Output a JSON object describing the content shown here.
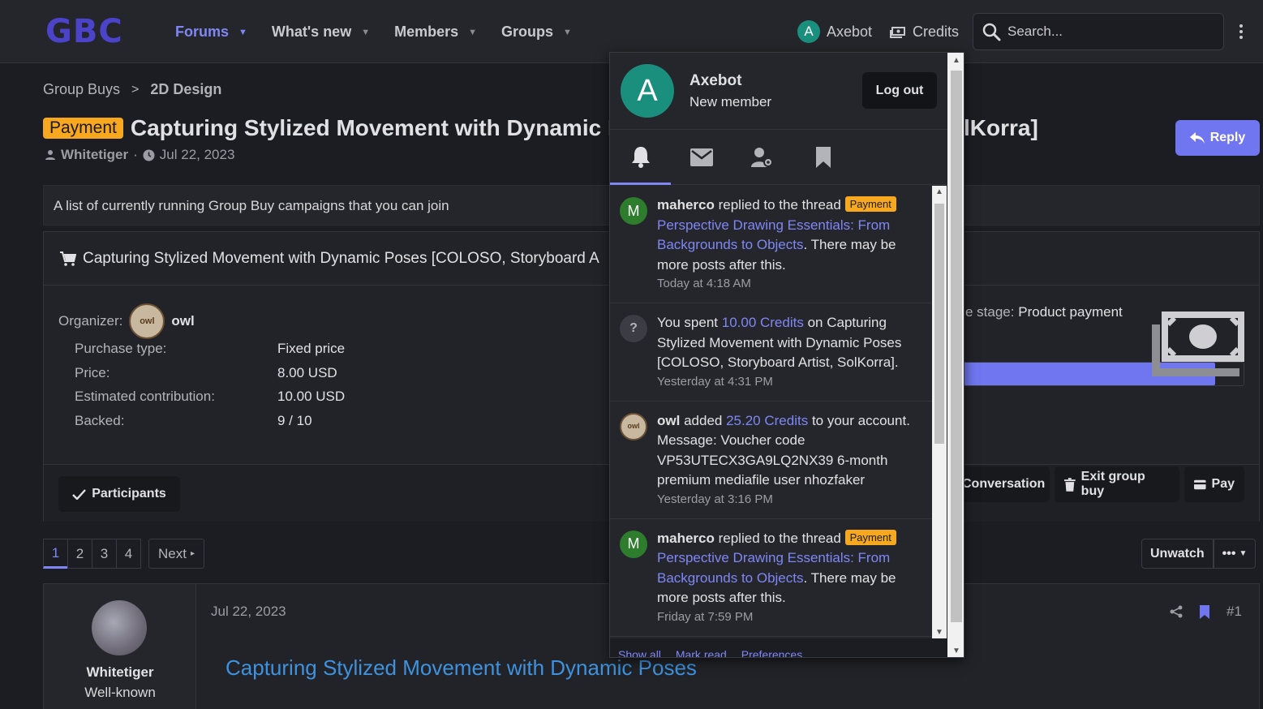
{
  "header": {
    "logo": "GBC",
    "nav": [
      {
        "label": "Forums",
        "active": true
      },
      {
        "label": "What's new",
        "active": false
      },
      {
        "label": "Members",
        "active": false
      },
      {
        "label": "Groups",
        "active": false
      }
    ],
    "user_initial": "A",
    "user_name": "Axebot",
    "credits_label": "Credits",
    "search_placeholder": "Search..."
  },
  "breadcrumb": [
    "Group Buys",
    "2D Design"
  ],
  "thread": {
    "prefix": "Payment",
    "title": "Capturing Stylized Movement with Dynamic Po",
    "title_tail": "lKorra]",
    "author": "Whitetiger",
    "date": "Jul 22, 2023",
    "reply_label": "Reply"
  },
  "description": "A list of currently running Group Buy campaigns that you can join",
  "groupbuy": {
    "heading": "Capturing Stylized Movement with Dynamic Poses [COLOSO, Storyboard A",
    "organizer_label": "Organizer:",
    "organizer_name": "owl",
    "owl_avatar_text": "owl",
    "details": [
      {
        "k": "Purchase type:",
        "v": "Fixed price"
      },
      {
        "k": "Price:",
        "v": "8.00 USD"
      },
      {
        "k": "Estimated contribution:",
        "v": "10.00 USD"
      },
      {
        "k": "Backed:",
        "v": "9 / 10"
      }
    ],
    "stage_label": "e stage:",
    "stage_value": "Product payment",
    "progress": 0.9,
    "participants_label": "Participants",
    "conversation_label": "Conversation",
    "exit_label": "Exit group buy",
    "pay_label": "Pay"
  },
  "pagination": {
    "pages": [
      "1",
      "2",
      "3",
      "4"
    ],
    "current": "1",
    "next_label": "Next",
    "unwatch_label": "Unwatch"
  },
  "post": {
    "author": "Whitetiger",
    "role": "Well-known",
    "date": "Jul 22, 2023",
    "title": "Capturing Stylized Movement with Dynamic Poses",
    "number": "#1"
  },
  "popup": {
    "initial": "A",
    "name": "Axebot",
    "role": "New member",
    "logout_label": "Log out",
    "notifications": [
      {
        "avatar": "M",
        "who": "maherco",
        "text1": "replied to the thread",
        "badge": "Payment",
        "link": "Perspective Drawing Essentials: From Backgrounds to Objects",
        "text2": ". There may be more posts after this.",
        "time": "Today at 4:18 AM"
      },
      {
        "avatar": "?",
        "pre": "You spent",
        "link": "10.00 Credits",
        "text2": "on Capturing Stylized Movement with Dynamic Poses [COLOSO, Storyboard Artist, SolKorra].",
        "time": "Yesterday at 4:31 PM"
      },
      {
        "avatar": "owl",
        "who": "owl",
        "text1": "added",
        "link": "25.20 Credits",
        "text2": "to your account. Message: Voucher code VP53UTECX3GA9LQ2NX39 6-month premium mediafile user nhozfaker",
        "time": "Yesterday at 3:16 PM"
      },
      {
        "avatar": "M",
        "who": "maherco",
        "text1": "replied to the thread",
        "badge": "Payment",
        "link": "Perspective Drawing Essentials: From Backgrounds to Objects",
        "text2": ". There may be more posts after this.",
        "time": "Friday at 7:59 PM"
      }
    ],
    "footer": [
      "Show all",
      "Mark read",
      "Preferences"
    ]
  },
  "colors": {
    "accent": "#7f87f5",
    "badge": "#f7a81f",
    "avatar_green": "#1a8f7e"
  }
}
